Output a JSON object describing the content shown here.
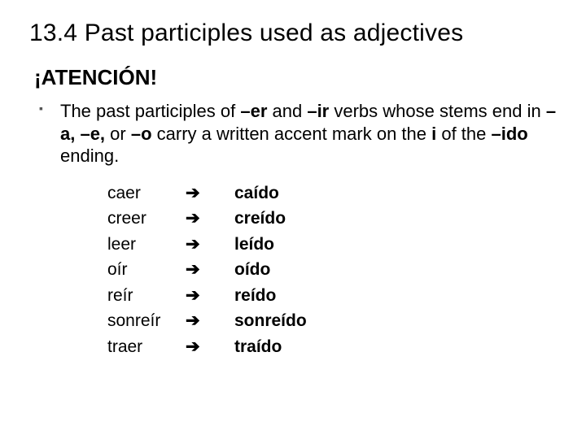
{
  "title": "13.4 Past participles used as adjectives",
  "subtitle": "¡ATENCIÓN!",
  "body": {
    "p1": "The past participles of ",
    "b1": "–er",
    "p2": " and ",
    "b2": "–ir",
    "p3": " verbs whose stems end in ",
    "b3": "–a, –e,",
    "p4": " or ",
    "b4": "–o",
    "p5": " carry a written accent mark on the ",
    "b5": "i",
    "p6": " of the ",
    "b6": "–ido",
    "p7": " ending."
  },
  "arrow": "➔",
  "rows": [
    {
      "inf": "caer",
      "pp": "caído"
    },
    {
      "inf": "creer",
      "pp": "creído"
    },
    {
      "inf": "leer",
      "pp": "leído"
    },
    {
      "inf": "oír",
      "pp": "oído"
    },
    {
      "inf": "reír",
      "pp": "reído"
    },
    {
      "inf": "sonreír",
      "pp": "sonreído"
    },
    {
      "inf": "traer",
      "pp": "traído"
    }
  ]
}
